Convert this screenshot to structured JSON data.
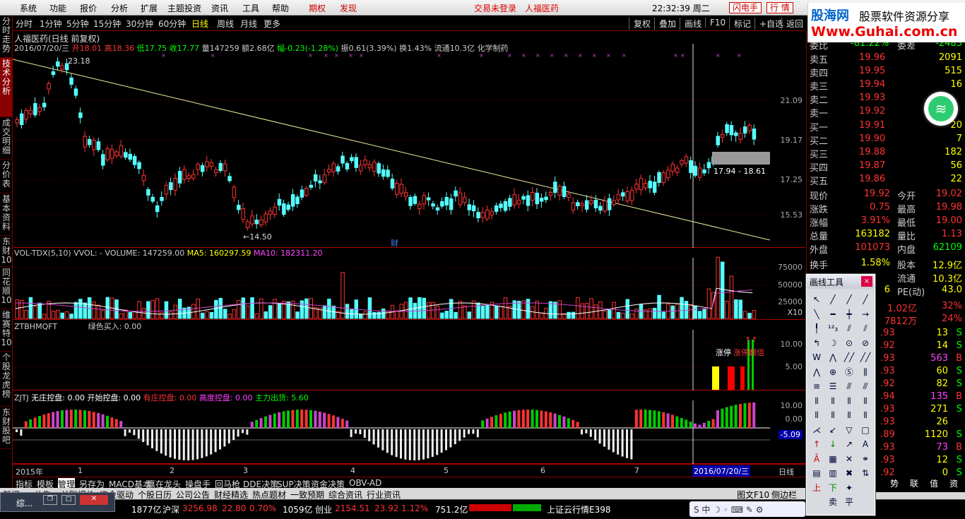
{
  "menubar": {
    "items": [
      "系统",
      "功能",
      "报价",
      "分析",
      "扩展",
      "主题投资",
      "资讯",
      "工具",
      "帮助"
    ],
    "special": [
      "期权",
      "发现"
    ],
    "status": "交易未登录",
    "stock_title": "人福医药",
    "clock": "22:32:39 周二",
    "buttons": [
      "闪电手",
      "行 情"
    ],
    "logo": {
      "brand": "股海网",
      "slogan": "股票软件资源分享",
      "url": "Www.Guhai.com.cn"
    }
  },
  "left_tabs": [
    "分时走势",
    "技术分析",
    "成交明细",
    "分价表",
    "基本资料",
    "东财10",
    "同花顺10",
    "维赛特10",
    "个股龙虎榜",
    "东财股吧"
  ],
  "period_bar": {
    "periods": [
      "分时",
      "1分钟",
      "5分钟",
      "15分钟",
      "30分钟",
      "60分钟",
      "日线",
      "周线",
      "月线",
      "更多"
    ],
    "selected": "日线",
    "tools": [
      "复权",
      "叠加",
      "画线",
      "F10",
      "标记",
      "+自选",
      "返回"
    ]
  },
  "main_chart": {
    "title": "人福医药(日线 前复权)",
    "info": {
      "date": "2016/07/20/三",
      "open_label": "开",
      "open": "18.01",
      "high_label": "高",
      "high": "18.36",
      "low_label": "低",
      "low": "17.75",
      "close_label": "收",
      "close": "17.77",
      "vol_label": "量",
      "vol": "147259",
      "amount_label": "额",
      "amount": "2.68亿",
      "change_label": "幅",
      "change": "-0.23(-1.28%)",
      "amp_label": "振",
      "amp": "0.61(3.39%)",
      "turn_label": "换",
      "turn": "1.43%",
      "float_label": "流通",
      "float": "10.3亿",
      "sector": "化学制药"
    },
    "y_ticks": [
      "21.09",
      "19.17",
      "17.25",
      "15.53"
    ],
    "annotations": {
      "high": "23.18",
      "low": "←14.50",
      "range_box": "17.94 - 18.61",
      "event": "财"
    }
  },
  "volume_chart": {
    "title": "VOL-TDX(5,10)",
    "vvol": "VVOL: -",
    "volume": "VOLUME: 147259.00",
    "ma5": "MA5: 160297.59",
    "ma10": "MA10: 182311.20",
    "y_ticks": [
      "75000",
      "50000",
      "25000"
    ],
    "unit": "X10"
  },
  "zt_chart": {
    "title": "ZTBHMQFT",
    "buy": "绿色买入: 0.00",
    "y_ticks": [
      "10.00",
      "5.00"
    ],
    "label": "涨停",
    "label2": "涨停翻倍"
  },
  "zj_chart": {
    "title": "ZJTJ",
    "items": [
      "无庄控盘: 0.00",
      "开始控盘: 0.00",
      "有庄控盘: 0.00",
      "高度控盘: 0.00",
      "主力出货: 5.60"
    ],
    "y_ticks": [
      "10.00",
      "0.00"
    ],
    "value_tag": "-5.09"
  },
  "x_axis": {
    "labels": [
      "2015年",
      "1",
      "2",
      "3",
      "4",
      "5",
      "6",
      "7"
    ],
    "cursor_date": "2016/07/20/三",
    "period": "日线"
  },
  "bottom_tabs": [
    "指标",
    "模板",
    "管理",
    "另存为",
    "MACD基本",
    "赢在龙头",
    "操盘手",
    "回马枪",
    "DDE决策",
    "SUP决策",
    "资金决策",
    "OBV-AD"
  ],
  "bottom_tabs_selected": "管理",
  "link_bar": [
    "新闻",
    "公告",
    "关联报价",
    "资金驱动",
    "个股日历",
    "公司公告",
    "财经精选",
    "热点题材",
    "一致预期",
    "综合资讯",
    "行业资讯"
  ],
  "link_bar_right": [
    "图文F10",
    "侧边栏"
  ],
  "quote": {
    "header": {
      "left_label": "委比",
      "left_val": "-81.22%",
      "right_label": "委差",
      "right_val": "-2483"
    },
    "sells": [
      {
        "label": "卖五",
        "price": "19.96",
        "vol": "2091"
      },
      {
        "label": "卖四",
        "price": "19.95",
        "vol": "515"
      },
      {
        "label": "卖三",
        "price": "19.94",
        "vol": "16"
      },
      {
        "label": "卖二",
        "price": "19.93",
        "vol": ""
      },
      {
        "label": "卖一",
        "price": "19.92",
        "vol": ""
      }
    ],
    "buys": [
      {
        "label": "买一",
        "price": "19.91",
        "vol": "20"
      },
      {
        "label": "买二",
        "price": "19.90",
        "vol": "7"
      },
      {
        "label": "买三",
        "price": "19.88",
        "vol": "182"
      },
      {
        "label": "买四",
        "price": "19.87",
        "vol": "56"
      },
      {
        "label": "买五",
        "price": "19.86",
        "vol": "22"
      }
    ],
    "stats": [
      {
        "l1": "现价",
        "v1": "19.92",
        "l2": "今开",
        "v2": "19.02"
      },
      {
        "l1": "涨跌",
        "v1": "0.75",
        "l2": "最高",
        "v2": "19.98"
      },
      {
        "l1": "涨幅",
        "v1": "3.91%",
        "l2": "最低",
        "v2": "19.00"
      },
      {
        "l1": "总量",
        "v1": "163182",
        "l2": "量比",
        "v2": "1.13"
      },
      {
        "l1": "外盘",
        "v1": "101073",
        "l2": "内盘",
        "v2": "62109"
      }
    ],
    "stats2": [
      {
        "l1": "换手",
        "v1": "1.58%",
        "l2": "股本",
        "v2": "12.9亿"
      },
      {
        "l1": "",
        "v1": "",
        "l2": "流通",
        "v2": "10.3亿"
      },
      {
        "l1": "",
        "v1": "6",
        "l2": "PE(动)",
        "v2": "43.0"
      }
    ],
    "flow": [
      {
        "v1": "1.02亿",
        "v2": "32%"
      },
      {
        "v1": "7812万",
        "v2": "24%"
      }
    ],
    "ticks": [
      {
        "p": ".93",
        "v": "13",
        "f": "S"
      },
      {
        "p": ".92",
        "v": "14",
        "f": "S"
      },
      {
        "p": ".93",
        "v": "563",
        "f": "B"
      },
      {
        "p": ".93",
        "v": "60",
        "f": "S"
      },
      {
        "p": ".92",
        "v": "82",
        "f": "S"
      },
      {
        "p": ".94",
        "v": "135",
        "f": "B"
      },
      {
        "p": ".93",
        "v": "271",
        "f": "S"
      },
      {
        "p": ".93",
        "v": "26",
        "f": ""
      },
      {
        "p": ".89",
        "v": "1120",
        "f": "S"
      },
      {
        "p": ".93",
        "v": "73",
        "f": "B"
      },
      {
        "p": ".93",
        "v": "12",
        "f": "S"
      },
      {
        "p": ".92",
        "v": "0",
        "f": "S"
      }
    ],
    "bottom_buttons": [
      "势",
      "联",
      "值",
      "资"
    ]
  },
  "draw_tools": {
    "title": "画线工具",
    "close": "×"
  },
  "status_bar": {
    "items": [
      "1877亿",
      "沪深",
      "3256.98",
      "22.80",
      "0.70%",
      "1059亿",
      "创业",
      "2154.51",
      "23.92",
      "1.12%",
      "751.2亿",
      "上证云行情E398"
    ]
  },
  "taskbar": {
    "label": "综..."
  }
}
